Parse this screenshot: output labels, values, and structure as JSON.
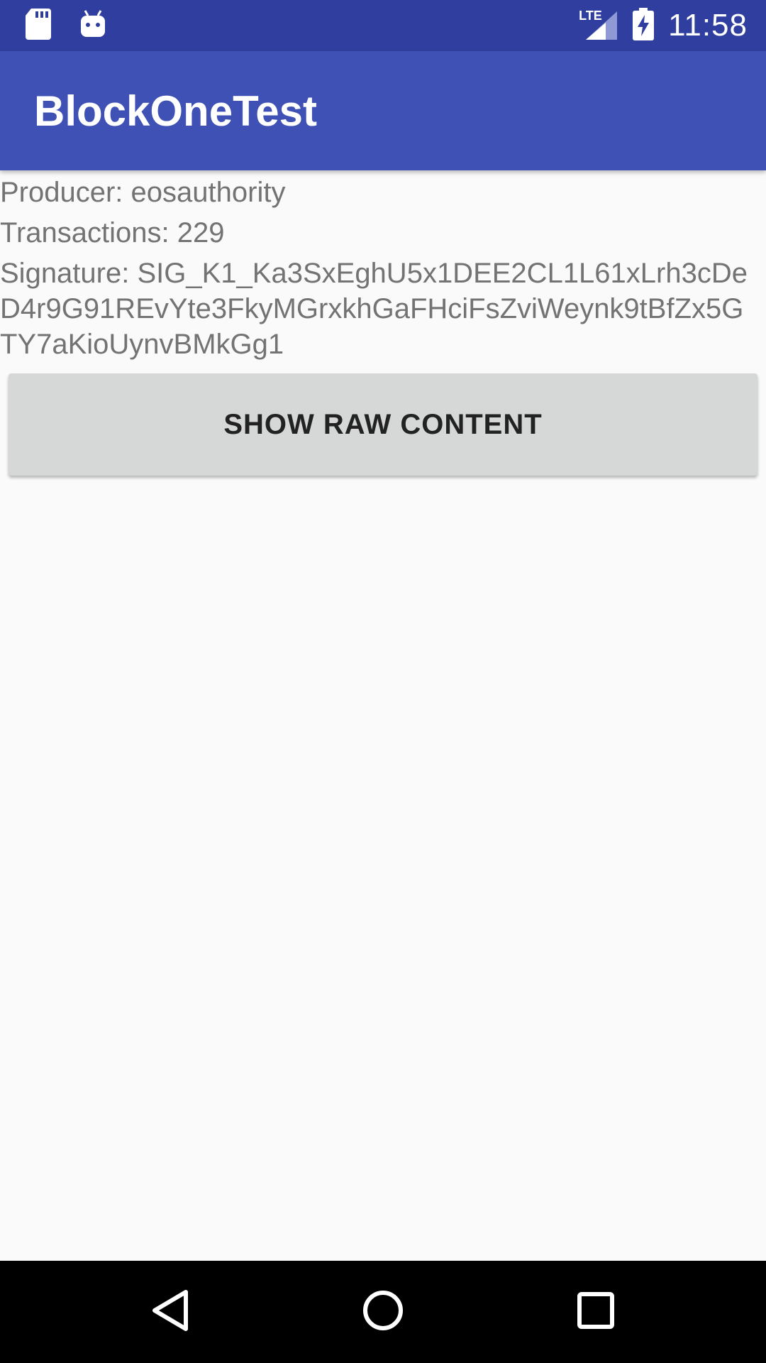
{
  "status_bar": {
    "time": "11:58",
    "network": "LTE",
    "icons": [
      "sd-card-icon",
      "android-icon",
      "lte-signal-icon",
      "battery-charging-icon"
    ],
    "background": "#303F9F"
  },
  "app_bar": {
    "title": "BlockOneTest",
    "background": "#3F51B5"
  },
  "block_info": {
    "producer": "Producer: eosauthority",
    "transactions": "Transactions: 229",
    "signature": "Signature: SIG_K1_Ka3SxEghU5x1DEE2CL1L61xLrh3cDeD4r9G91REvYte3FkyMGrxkhGaFHciFsZviWeynk9tBfZx5GTY7aKioUynvBMkGg1"
  },
  "actions": {
    "show_raw_label": "SHOW RAW CONTENT"
  },
  "nav_bar": {
    "icons": [
      "back-icon",
      "home-icon",
      "recents-icon"
    ]
  }
}
